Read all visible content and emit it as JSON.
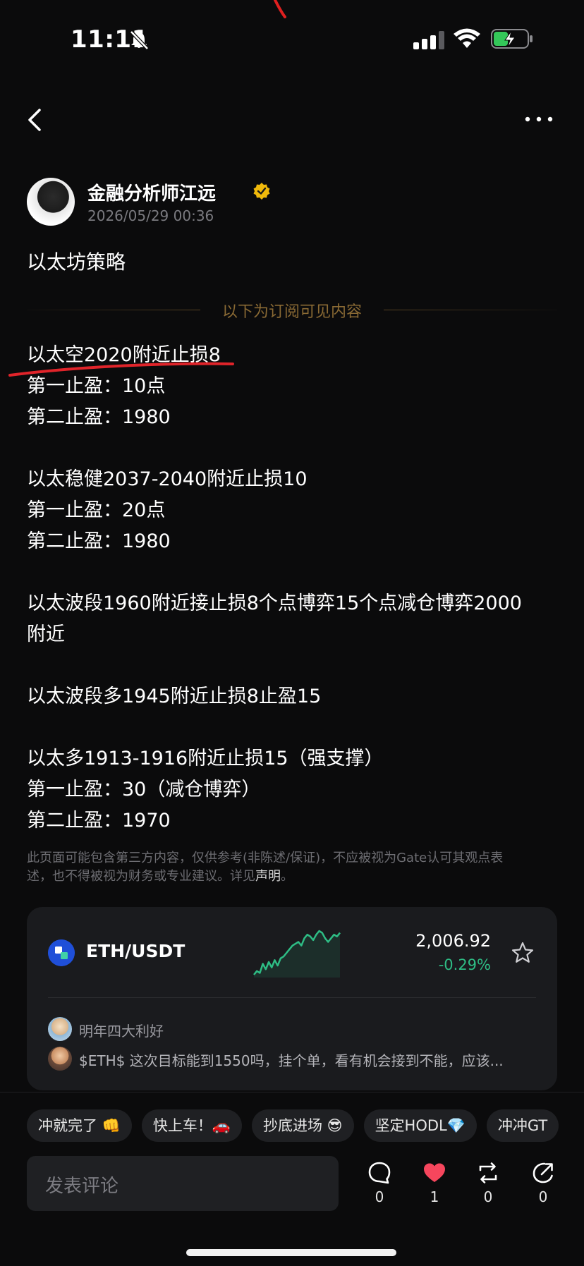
{
  "status_bar": {
    "time": "11:11"
  },
  "author": {
    "name": "金融分析师江远",
    "date": "2026/05/29 00:36"
  },
  "post": {
    "title": "以太坊策略",
    "subscriber_divider": "以下为订阅可见内容",
    "lines": [
      "以太空2020附近止损8",
      "第一止盈：10点",
      "第二止盈：1980",
      "",
      "以太稳健2037-2040附近止损10",
      "第一止盈：20点",
      "第二止盈：1980",
      "",
      "以太波段1960附近接止损8个点博弈15个点减仓博弈2000",
      "附近",
      "",
      "以太波段多1945附近止损8止盈15",
      "",
      "以太多1913-1916附近止损15（强支撑）",
      "第一止盈：30（减仓博弈）",
      "第二止盈：1970"
    ],
    "disclaimer_line1": "此页面可能包含第三方内容，仅供参考(非陈述/保证)，不应被视为Gate认可其观点表",
    "disclaimer_line2": "述，也不得被视为财务或专业建议。详见",
    "disclaimer_link": "声明",
    "disclaimer_end": "。"
  },
  "market_card": {
    "pair": "ETH/USDT",
    "price": "2,006.92",
    "change": "-0.29%",
    "sparkline": [
      62,
      58,
      60,
      50,
      56,
      48,
      54,
      46,
      52,
      44,
      42,
      38,
      34,
      30,
      28,
      26,
      30,
      22,
      18,
      20,
      24,
      18,
      14,
      16,
      22,
      26,
      22,
      18,
      20,
      16
    ],
    "colors": {
      "up": "#2ebd85",
      "icon": "#1f4fd8"
    },
    "comments": [
      {
        "text": "明年四大利好"
      },
      {
        "text": "$ETH$  这次目标能到1550吗，挂个单，看有机会接到不能，应该..."
      }
    ]
  },
  "bottom_bar": {
    "chips": [
      "冲就完了 👊",
      "快上车！🚗",
      "抄底进场 😎",
      "坚定HODL💎",
      "冲冲GT"
    ],
    "comment_placeholder": "发表评论",
    "actions": [
      {
        "icon": "comment-icon",
        "count": "0"
      },
      {
        "icon": "heart-icon",
        "count": "1"
      },
      {
        "icon": "repost-icon",
        "count": "0"
      },
      {
        "icon": "share-icon",
        "count": "0"
      }
    ]
  }
}
